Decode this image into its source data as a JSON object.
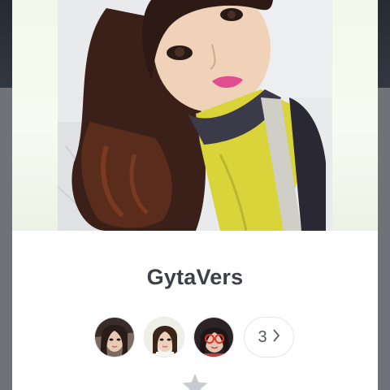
{
  "profile": {
    "name": "GytaVers",
    "cover_icon": "profile-cover-photo"
  },
  "friends": {
    "avatars": [
      {
        "icon": "friend-avatar-1"
      },
      {
        "icon": "friend-avatar-2"
      },
      {
        "icon": "friend-avatar-3"
      }
    ],
    "more_count": "3",
    "more_icon": "chevron-right-icon"
  },
  "actions": {
    "favorite_icon": "star-icon"
  },
  "colors": {
    "name_text": "#3c4047",
    "card_background": "#ffffff",
    "overlay_dark": "#2a2f37",
    "star_gray": "#c8cbd0"
  }
}
